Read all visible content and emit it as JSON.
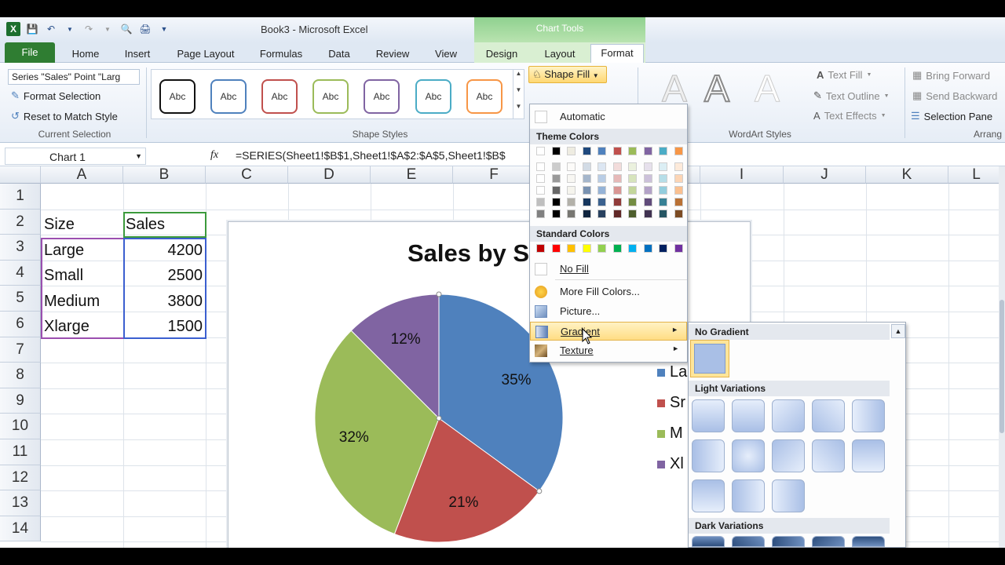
{
  "window": {
    "title": "Book3 - Microsoft Excel",
    "context_tools": "Chart Tools"
  },
  "tabs": [
    "File",
    "Home",
    "Insert",
    "Page Layout",
    "Formulas",
    "Data",
    "Review",
    "View",
    "Design",
    "Layout",
    "Format"
  ],
  "current_selection": {
    "dropdown_value": "Series \"Sales\" Point \"Larg",
    "format_selection": "Format Selection",
    "reset_to_match_style": "Reset to Match Style",
    "group_label": "Current Selection"
  },
  "shape_styles": {
    "swatch_label": "Abc",
    "group_label": "Shape Styles",
    "swatch_colors": [
      "#111111",
      "#4f81bd",
      "#c0504d",
      "#9bbb59",
      "#8064a2",
      "#4bacc6",
      "#f79646"
    ]
  },
  "shape_fill": {
    "label": "Shape Fill"
  },
  "wordart": {
    "text_fill": "Text Fill",
    "text_outline": "Text Outline",
    "text_effects": "Text Effects",
    "group_label": "WordArt Styles"
  },
  "arrange": {
    "bring_forward": "Bring Forward",
    "send_backward": "Send Backward",
    "selection_pane": "Selection Pane",
    "group_label": "Arrang"
  },
  "formula_bar": {
    "name_box": "Chart 1",
    "fx": "fx",
    "formula": "=SERIES(Sheet1!$B$1,Sheet1!$A$2:$A$5,Sheet1!$B$"
  },
  "grid": {
    "columns": [
      "A",
      "B",
      "C",
      "D",
      "E",
      "F",
      "I",
      "J",
      "K",
      "L"
    ],
    "rows": [
      "1",
      "2",
      "3",
      "4",
      "5",
      "6",
      "7",
      "8",
      "9",
      "10",
      "11",
      "12",
      "13",
      "14"
    ],
    "cells": {
      "a1": "Size",
      "b1": "Sales",
      "a2": "Large",
      "b2": "4200",
      "a3": "Small",
      "b3": "2500",
      "a4": "Medium",
      "b4": "3800",
      "a5": "Xlarge",
      "b5": "1500"
    }
  },
  "chart": {
    "title": "Sales by S",
    "legend": [
      "La",
      "Sr",
      "M",
      "Xl"
    ]
  },
  "chart_data": {
    "type": "pie",
    "title": "Sales by S",
    "categories": [
      "Large",
      "Small",
      "Medium",
      "Xlarge"
    ],
    "values": [
      4200,
      2500,
      3800,
      1500
    ],
    "percent_labels": [
      "35%",
      "21%",
      "32%",
      "12%"
    ],
    "colors": [
      "#4f81bd",
      "#c0504d",
      "#9bbb59",
      "#8064a2"
    ],
    "legend_labels": [
      "La",
      "Sr",
      "M",
      "Xl"
    ],
    "legend_position": "right"
  },
  "fill_menu": {
    "automatic": "Automatic",
    "theme_colors_header": "Theme Colors",
    "standard_colors_header": "Standard Colors",
    "no_fill": "No Fill",
    "more_fill_colors": "More Fill Colors...",
    "picture": "Picture...",
    "gradient": "Gradient",
    "texture": "Texture",
    "theme_colors": [
      "#ffffff",
      "#000000",
      "#eeece1",
      "#1f497d",
      "#4f81bd",
      "#c0504d",
      "#9bbb59",
      "#8064a2",
      "#4bacc6",
      "#f79646"
    ],
    "standard_colors": [
      "#c00000",
      "#ff0000",
      "#ffc000",
      "#ffff00",
      "#92d050",
      "#00b050",
      "#00b0f0",
      "#0070c0",
      "#002060",
      "#7030a0"
    ]
  },
  "gradient_menu": {
    "no_gradient": "No Gradient",
    "light_variations": "Light Variations",
    "dark_variations": "Dark Variations",
    "light_color": "#a9bfe6",
    "dark_color": "#2e4f7e"
  }
}
